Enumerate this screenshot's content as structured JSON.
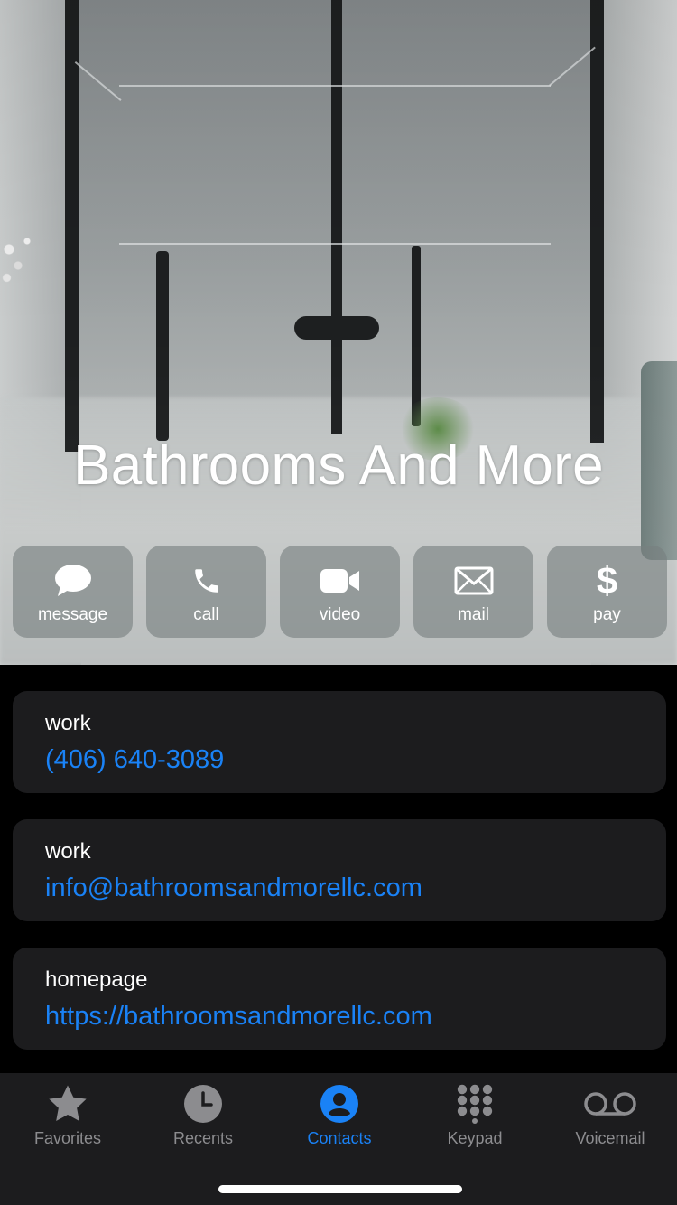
{
  "contact": {
    "name": "Bathrooms And More"
  },
  "actions": [
    {
      "label": "message",
      "icon": "message-bubble-icon"
    },
    {
      "label": "call",
      "icon": "phone-icon"
    },
    {
      "label": "video",
      "icon": "video-camera-icon"
    },
    {
      "label": "mail",
      "icon": "envelope-icon"
    },
    {
      "label": "pay",
      "icon": "dollar-icon",
      "glyph": "$"
    }
  ],
  "fields": [
    {
      "label": "work",
      "value": "(406) 640-3089"
    },
    {
      "label": "work",
      "value": "info@bathroomsandmorellc.com"
    },
    {
      "label": "homepage",
      "value": "https://bathroomsandmorellc.com"
    }
  ],
  "tabbar": {
    "tabs": [
      {
        "label": "Favorites",
        "icon": "star-icon",
        "active": false
      },
      {
        "label": "Recents",
        "icon": "clock-icon",
        "active": false
      },
      {
        "label": "Contacts",
        "icon": "person-circle-icon",
        "active": true
      },
      {
        "label": "Keypad",
        "icon": "keypad-grid-icon",
        "active": false
      },
      {
        "label": "Voicemail",
        "icon": "voicemail-icon",
        "active": false
      }
    ]
  },
  "colors": {
    "accent": "#1a82f6",
    "card_background": "#1c1c1e",
    "inactive_tab": "#8c8c8f"
  }
}
